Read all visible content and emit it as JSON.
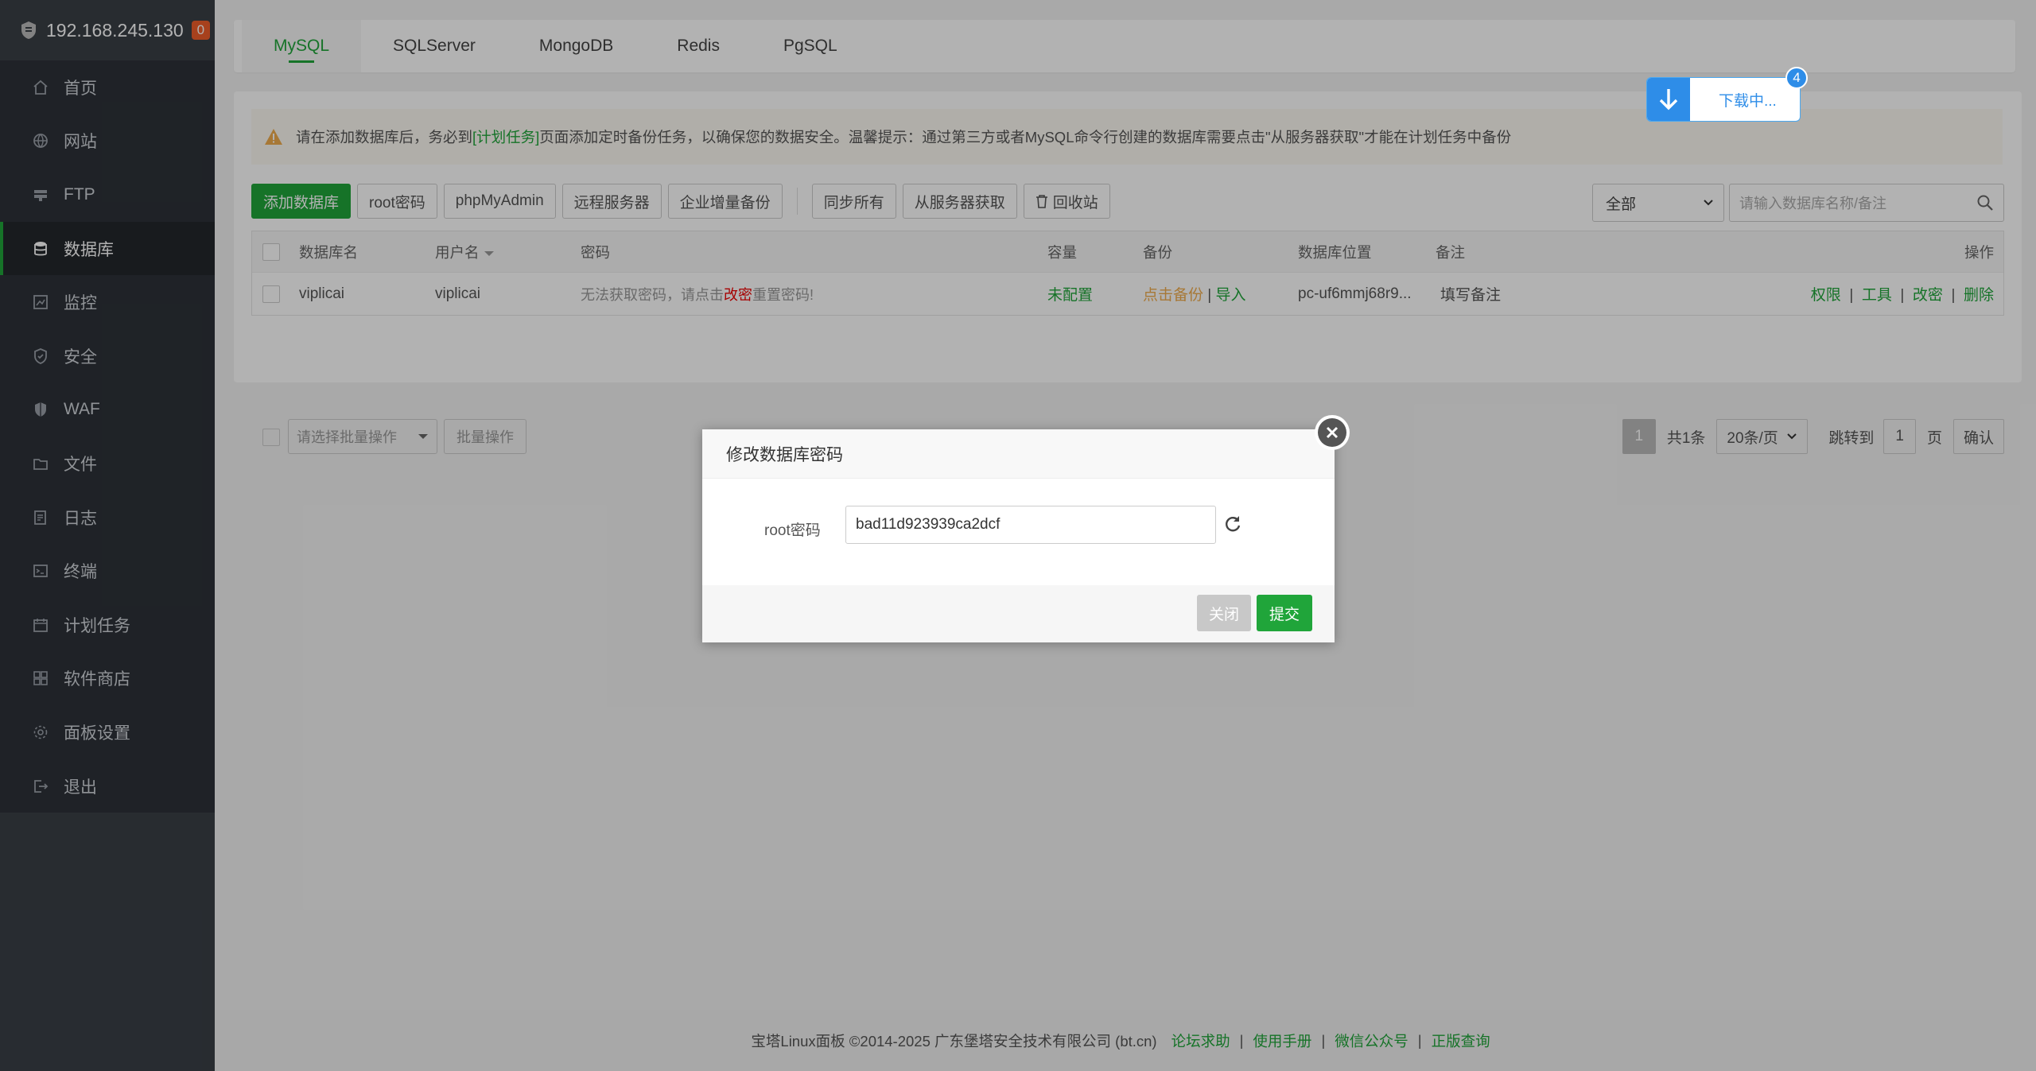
{
  "sidebar": {
    "host": "192.168.245.130",
    "alert_count": "0",
    "items": [
      {
        "label": "首页",
        "icon": "home-icon"
      },
      {
        "label": "网站",
        "icon": "globe-icon"
      },
      {
        "label": "FTP",
        "icon": "ftp-icon"
      },
      {
        "label": "数据库",
        "icon": "database-icon"
      },
      {
        "label": "监控",
        "icon": "monitor-icon"
      },
      {
        "label": "安全",
        "icon": "shield-icon"
      },
      {
        "label": "WAF",
        "icon": "waf-icon"
      },
      {
        "label": "文件",
        "icon": "folder-icon"
      },
      {
        "label": "日志",
        "icon": "log-icon"
      },
      {
        "label": "终端",
        "icon": "terminal-icon"
      },
      {
        "label": "计划任务",
        "icon": "calendar-icon"
      },
      {
        "label": "软件商店",
        "icon": "apps-icon"
      },
      {
        "label": "面板设置",
        "icon": "gear-icon"
      },
      {
        "label": "退出",
        "icon": "logout-icon"
      }
    ]
  },
  "tabs": [
    "MySQL",
    "SQLServer",
    "MongoDB",
    "Redis",
    "PgSQL"
  ],
  "notice": {
    "before": "请在添加数据库后，务必到",
    "link": "[计划任务]",
    "after": "页面添加定时备份任务，以确保您的数据安全。温馨提示：通过第三方或者MySQL命令行创建的数据库需要点击\"从服务器获取\"才能在计划任务中备份"
  },
  "toolbar": {
    "add": "添加数据库",
    "root_pw": "root密码",
    "phpmyadmin": "phpMyAdmin",
    "remote": "远程服务器",
    "incremental": "企业增量备份",
    "sync_all": "同步所有",
    "fetch": "从服务器获取",
    "recycle": "回收站",
    "filter": "全部",
    "search_placeholder": "请输入数据库名称/备注"
  },
  "table": {
    "headers": {
      "name": "数据库名",
      "user": "用户名",
      "password": "密码",
      "size": "容量",
      "backup": "备份",
      "location": "数据库位置",
      "remark": "备注",
      "ops": "操作"
    },
    "row": {
      "name": "viplicai",
      "user": "viplicai",
      "pw_before": "无法获取密码，请点击",
      "pw_link": "改密",
      "pw_after": "重置密码!",
      "size": "未配置",
      "backup_link": "点击备份",
      "import": "导入",
      "location": "pc-uf6mmj68r9...",
      "remark": "填写备注",
      "op1": "权限",
      "op2": "工具",
      "op3": "改密",
      "op4": "删除"
    }
  },
  "batch": {
    "select": "请选择批量操作",
    "button": "批量操作"
  },
  "pager": {
    "page": "1",
    "total": "共1条",
    "per_page": "20条/页",
    "jump": "跳转到",
    "jump_value": "1",
    "page_unit": "页",
    "confirm": "确认"
  },
  "download": {
    "label": "下载中...",
    "count": "4"
  },
  "modal": {
    "title": "修改数据库密码",
    "label": "root密码",
    "value": "bad11d923939ca2dcf",
    "close": "关闭",
    "submit": "提交"
  },
  "footer": {
    "copyright": "宝塔Linux面板 ©2014-2025 广东堡塔安全技术有限公司 (bt.cn)",
    "links": [
      "论坛求助",
      "使用手册",
      "微信公众号",
      "正版查询"
    ]
  },
  "colors": {
    "brand": "#20a53a",
    "sidebar": "#3a3f46",
    "warn": "#f0ad4e",
    "download": "#2e8de8"
  }
}
